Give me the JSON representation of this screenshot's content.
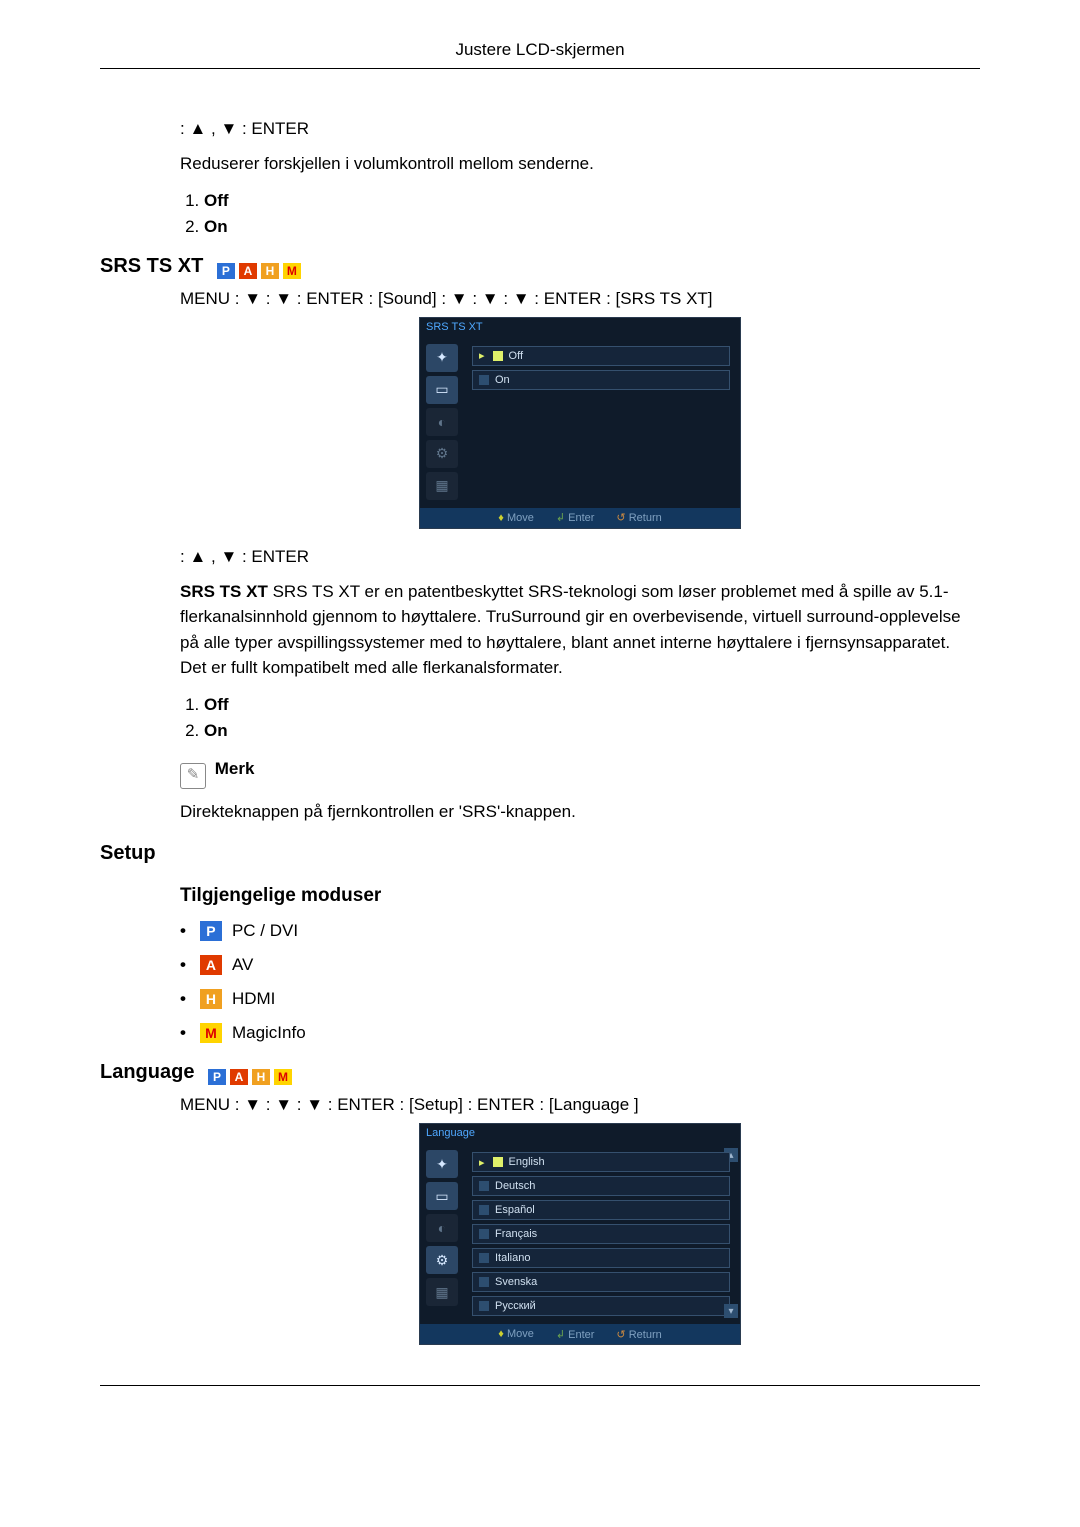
{
  "page_header": "Justere LCD-skjermen",
  "nav_line_1": " :  ▲ , ▼  : ENTER",
  "auto_volume_desc": "Reduserer forskjellen i volumkontroll mellom senderne.",
  "option_off": "Off",
  "option_on": "On",
  "srs": {
    "heading": "SRS TS XT",
    "path": "MENU  :  ▼  :  ▼  : ENTER  : [Sound]  :    ▼ :  ▼ :  ▼ : ENTER  : [SRS TS XT]",
    "nav_line": " :  ▲ , ▼  : ENTER",
    "para": "SRS TS XT er en patentbeskyttet SRS-teknologi som løser problemet med å spille av 5.1-flerkanalsinnhold gjennom to høyttalere. TruSurround gir en overbevisende, virtuell surround-opplevelse på alle typer avspillingssystemer med to høyttalere, blant annet interne høyttalere i fjernsynsapparatet. Det er fullt kompatibelt med alle flerkanalsformater.",
    "note_label": "Merk",
    "note_text": "Direkteknappen på fjernkontrollen er 'SRS'-knappen.",
    "osd": {
      "title": "SRS TS XT",
      "items": [
        "Off",
        "On"
      ],
      "footer": {
        "move": "Move",
        "enter": "Enter",
        "return": "Return"
      }
    }
  },
  "setup": {
    "heading": "Setup",
    "modes_heading": "Tilgjengelige moduser",
    "modes": [
      {
        "icon": "P",
        "label": "PC / DVI"
      },
      {
        "icon": "A",
        "label": "AV"
      },
      {
        "icon": "H",
        "label": "HDMI"
      },
      {
        "icon": "M",
        "label": "MagicInfo"
      }
    ]
  },
  "language": {
    "heading": "Language",
    "path": "MENU  :  ▼  :  ▼  :  ▼  : ENTER  : [Setup]  : ENTER  : [Language ]",
    "osd": {
      "title": "Language",
      "items": [
        "English",
        "Deutsch",
        "Español",
        "Français",
        "Italiano",
        "Svenska",
        "Русский"
      ],
      "footer": {
        "move": "Move",
        "enter": "Enter",
        "return": "Return"
      }
    }
  },
  "chips": {
    "p": "P",
    "a": "A",
    "h": "H",
    "m": "M"
  }
}
